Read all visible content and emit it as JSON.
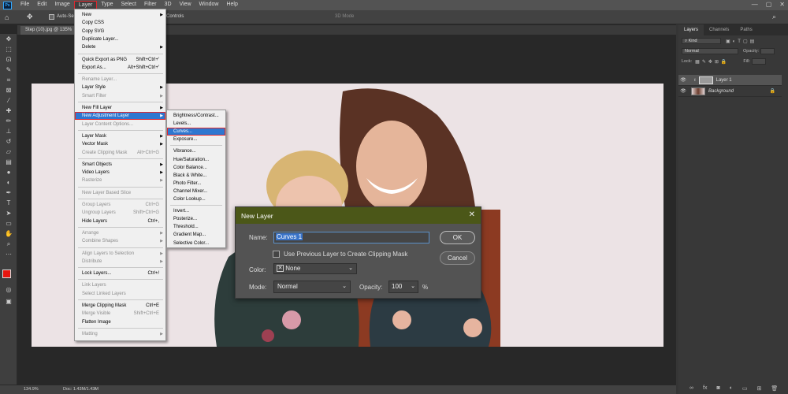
{
  "app": {
    "logo": "Ps"
  },
  "menubar": {
    "items": [
      "File",
      "Edit",
      "Image",
      "Layer",
      "Type",
      "Select",
      "Filter",
      "3D",
      "View",
      "Window",
      "Help"
    ],
    "active": "Layer"
  },
  "window_controls": {
    "minimize": "—",
    "maximize": "▢",
    "close": "✕"
  },
  "options_bar": {
    "auto_select": "Auto-Se",
    "transform_controls": "Controls",
    "mode_3d": "3D Mode"
  },
  "document": {
    "tab_title": "Step (10).jpg @ 135%"
  },
  "status_bar": {
    "zoom": "134.9%",
    "doc_info": "Doc: 1.43M/1.43M"
  },
  "layer_menu": {
    "items": [
      {
        "label": "New",
        "shortcut": "",
        "submenu": true,
        "disabled": false
      },
      {
        "label": "Copy CSS",
        "shortcut": "",
        "submenu": false,
        "disabled": false
      },
      {
        "label": "Copy SVG",
        "shortcut": "",
        "submenu": false,
        "disabled": false
      },
      {
        "label": "Duplicate Layer...",
        "shortcut": "",
        "submenu": false,
        "disabled": false
      },
      {
        "label": "Delete",
        "shortcut": "",
        "submenu": true,
        "disabled": false
      },
      {
        "label": "Quick Export as PNG",
        "shortcut": "Shift+Ctrl+'",
        "submenu": false,
        "disabled": false
      },
      {
        "label": "Export As...",
        "shortcut": "Alt+Shift+Ctrl+'",
        "submenu": false,
        "disabled": false
      },
      {
        "label": "Rename Layer...",
        "shortcut": "",
        "submenu": false,
        "disabled": true
      },
      {
        "label": "Layer Style",
        "shortcut": "",
        "submenu": true,
        "disabled": false
      },
      {
        "label": "Smart Filter",
        "shortcut": "",
        "submenu": true,
        "disabled": true
      },
      {
        "label": "New Fill Layer",
        "shortcut": "",
        "submenu": true,
        "disabled": false
      },
      {
        "label": "New Adjustment Layer",
        "shortcut": "",
        "submenu": true,
        "disabled": false
      },
      {
        "label": "Layer Content Options...",
        "shortcut": "",
        "submenu": false,
        "disabled": true
      },
      {
        "label": "Layer Mask",
        "shortcut": "",
        "submenu": true,
        "disabled": false
      },
      {
        "label": "Vector Mask",
        "shortcut": "",
        "submenu": true,
        "disabled": false
      },
      {
        "label": "Create Clipping Mask",
        "shortcut": "Alt+Ctrl+G",
        "submenu": false,
        "disabled": true
      },
      {
        "label": "Smart Objects",
        "shortcut": "",
        "submenu": true,
        "disabled": false
      },
      {
        "label": "Video Layers",
        "shortcut": "",
        "submenu": true,
        "disabled": false
      },
      {
        "label": "Rasterize",
        "shortcut": "",
        "submenu": true,
        "disabled": true
      },
      {
        "label": "New Layer Based Slice",
        "shortcut": "",
        "submenu": false,
        "disabled": true
      },
      {
        "label": "Group Layers",
        "shortcut": "Ctrl+G",
        "submenu": false,
        "disabled": true
      },
      {
        "label": "Ungroup Layers",
        "shortcut": "Shift+Ctrl+G",
        "submenu": false,
        "disabled": true
      },
      {
        "label": "Hide Layers",
        "shortcut": "Ctrl+,",
        "submenu": false,
        "disabled": false
      },
      {
        "label": "Arrange",
        "shortcut": "",
        "submenu": true,
        "disabled": true
      },
      {
        "label": "Combine Shapes",
        "shortcut": "",
        "submenu": true,
        "disabled": true
      },
      {
        "label": "Align Layers to Selection",
        "shortcut": "",
        "submenu": true,
        "disabled": true
      },
      {
        "label": "Distribute",
        "shortcut": "",
        "submenu": true,
        "disabled": true
      },
      {
        "label": "Lock Layers...",
        "shortcut": "Ctrl+/",
        "submenu": false,
        "disabled": false
      },
      {
        "label": "Link Layers",
        "shortcut": "",
        "submenu": false,
        "disabled": true
      },
      {
        "label": "Select Linked Layers",
        "shortcut": "",
        "submenu": false,
        "disabled": true
      },
      {
        "label": "Merge Clipping Mask",
        "shortcut": "Ctrl+E",
        "submenu": false,
        "disabled": false
      },
      {
        "label": "Merge Visible",
        "shortcut": "Shift+Ctrl+E",
        "submenu": false,
        "disabled": true
      },
      {
        "label": "Flatten Image",
        "shortcut": "",
        "submenu": false,
        "disabled": false
      },
      {
        "label": "Matting",
        "shortcut": "",
        "submenu": true,
        "disabled": true
      }
    ]
  },
  "adjustment_submenu": {
    "items": [
      "Brightness/Contrast...",
      "Levels...",
      "Curves...",
      "Exposure...",
      "Vibrance...",
      "Hue/Saturation...",
      "Color Balance...",
      "Black & White...",
      "Photo Filter...",
      "Channel Mixer...",
      "Color Lookup...",
      "Invert...",
      "Posterize...",
      "Threshold...",
      "Gradient Map...",
      "Selective Color..."
    ]
  },
  "dialog": {
    "title": "New Layer",
    "name_label": "Name:",
    "name_value": "Curves 1",
    "clipping_label": "Use Previous Layer to Create Clipping Mask",
    "color_label": "Color:",
    "color_value": "None",
    "mode_label": "Mode:",
    "mode_value": "Normal",
    "opacity_label": "Opacity:",
    "opacity_value": "100",
    "opacity_unit": "%",
    "ok": "OK",
    "cancel": "Cancel"
  },
  "layers_panel": {
    "tabs": [
      "Layers",
      "Channels",
      "Paths"
    ],
    "kind": "Kind",
    "blend_mode": "Normal",
    "opacity_label": "Opacity:",
    "lock_label": "Lock:",
    "fill_label": "Fill:",
    "layers": [
      "Layer 1",
      "Background"
    ]
  },
  "colors": {
    "foreground": "#e8160f",
    "background": "#ffffff",
    "dialog_title": "#4b5718",
    "highlight": "#2e77d0"
  }
}
